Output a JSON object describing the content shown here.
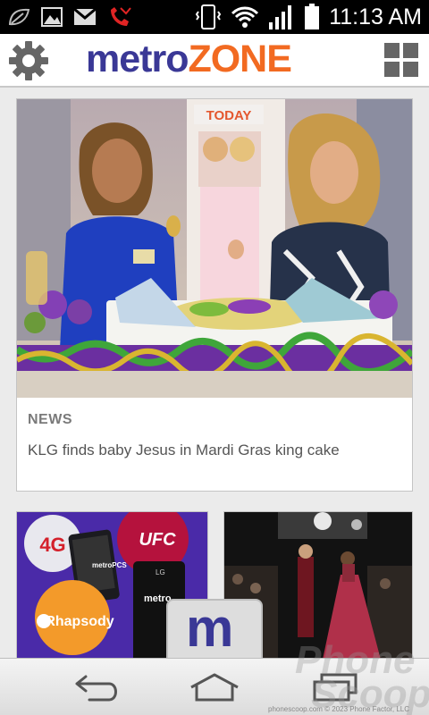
{
  "status_bar": {
    "time": "11:13 AM",
    "icons": [
      "leaf-icon",
      "image-icon",
      "gmail-icon",
      "missed-call-icon",
      "vibrate-icon",
      "wifi-icon",
      "signal-icon",
      "battery-icon"
    ]
  },
  "header": {
    "logo_part1": "metro",
    "logo_part2": "ZONE",
    "left_icon": "gear-icon",
    "right_icon": "grid-icon"
  },
  "main_story": {
    "category": "NEWS",
    "headline": "KLG finds baby Jesus in Mardi Gras king cake",
    "banner_text": "TODAY"
  },
  "promo_card": {
    "badge_4g": "4G",
    "ufc_label": "UFC",
    "rhapsody_label": "Rhapsody",
    "phone_brand_1": "metroPCS",
    "phone_brand_2": "LG",
    "phone_brand_3": "metro"
  },
  "bottom_tab": {
    "label": "m"
  },
  "watermark": {
    "line1": "Phone",
    "line2": "Scoop",
    "credit": "phonescoop.com  © 2023 Phone Factor, LLC"
  },
  "colors": {
    "brand_blue": "#3a3896",
    "brand_orange": "#f26a21",
    "ufc_red": "#b5123d",
    "promo_purple": "#4a2aa8"
  }
}
